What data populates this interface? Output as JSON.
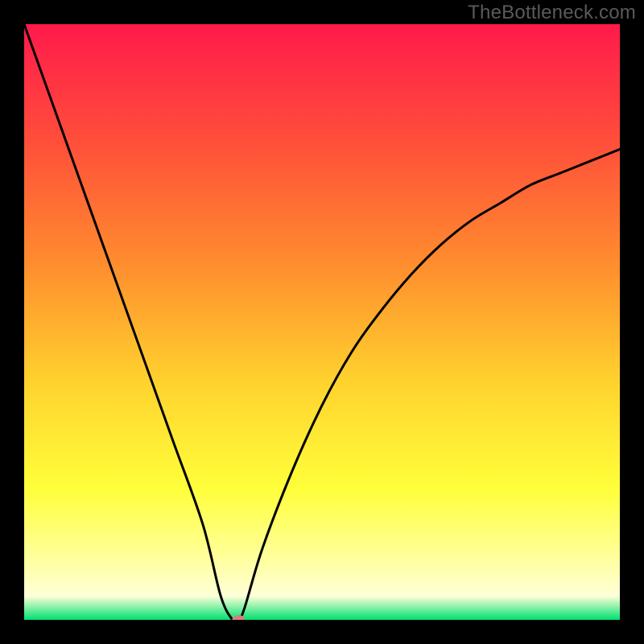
{
  "watermark": "TheBottleneck.com",
  "chart_data": {
    "type": "line",
    "title": "",
    "xlabel": "",
    "ylabel": "",
    "xlim": [
      0,
      100
    ],
    "ylim": [
      0,
      100
    ],
    "x": [
      0,
      5,
      10,
      15,
      20,
      25,
      30,
      33,
      35,
      36,
      37,
      40,
      45,
      50,
      55,
      60,
      65,
      70,
      75,
      80,
      85,
      90,
      95,
      100
    ],
    "values": [
      100,
      86,
      72,
      58,
      44,
      30,
      16,
      4,
      0,
      0,
      2,
      12,
      25,
      36,
      45,
      52,
      58,
      63,
      67,
      70,
      73,
      75,
      77,
      79
    ],
    "gradient_stops": [
      {
        "offset": 0.0,
        "color": "#ff1a4b"
      },
      {
        "offset": 0.2,
        "color": "#ff4f3a"
      },
      {
        "offset": 0.4,
        "color": "#ff8c2e"
      },
      {
        "offset": 0.6,
        "color": "#ffd22e"
      },
      {
        "offset": 0.78,
        "color": "#ffff3a"
      },
      {
        "offset": 0.9,
        "color": "#ffffa0"
      },
      {
        "offset": 0.96,
        "color": "#ffffd8"
      },
      {
        "offset": 1.0,
        "color": "#00e070"
      }
    ],
    "marker": {
      "x": 36,
      "y": 0,
      "color": "#d08080"
    }
  }
}
